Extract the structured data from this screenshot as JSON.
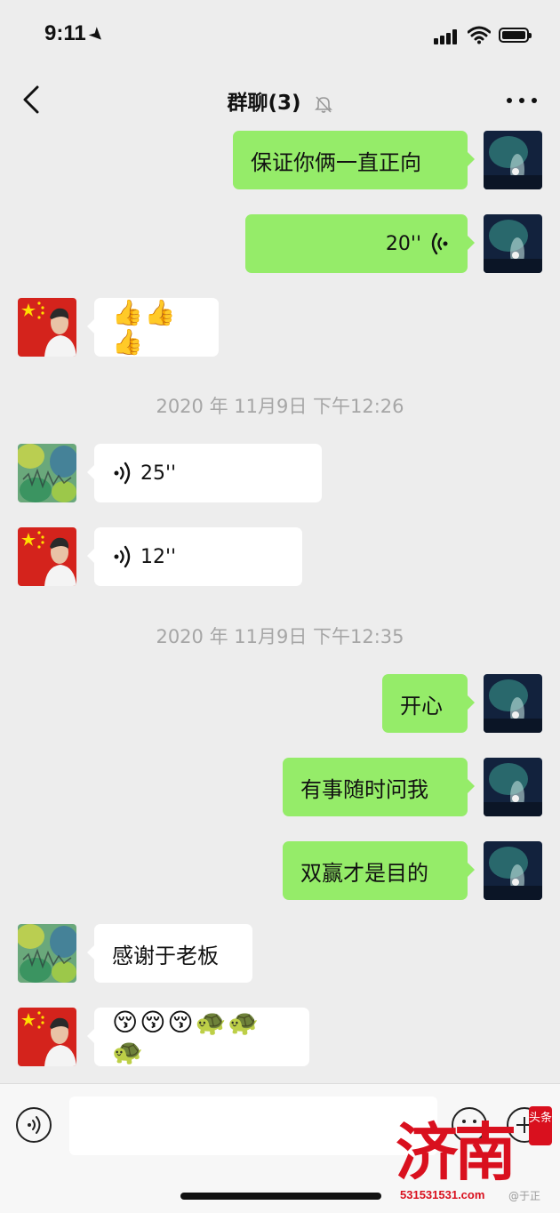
{
  "status_bar": {
    "time": "9:11"
  },
  "nav": {
    "title": "群聊(3)"
  },
  "timestamps": [
    "2020 年 11月9日 下午12:26",
    "2020 年 11月9日 下午12:35"
  ],
  "messages": [
    {
      "sender": "me",
      "type": "text",
      "text": "保证你俩一直正向"
    },
    {
      "sender": "me",
      "type": "voice",
      "duration": "20''"
    },
    {
      "sender": "other-flag",
      "type": "emoji",
      "text": "👍👍👍"
    },
    {
      "sender": "other-colorful",
      "type": "voice",
      "duration": "25''"
    },
    {
      "sender": "other-flag",
      "type": "voice",
      "duration": "12''"
    },
    {
      "sender": "me",
      "type": "text",
      "text": "开心"
    },
    {
      "sender": "me",
      "type": "text",
      "text": "有事随时问我"
    },
    {
      "sender": "me",
      "type": "text",
      "text": "双赢才是目的"
    },
    {
      "sender": "other-colorful",
      "type": "text",
      "text": "感谢于老板"
    },
    {
      "sender": "other-flag",
      "type": "emoji",
      "text": "😚😚😚🐢🐢🐢"
    }
  ],
  "input_bar": {
    "placeholder": ""
  },
  "watermark": {
    "text": "济南",
    "seal": "头条",
    "url": "531531531.com",
    "credit": "@于正"
  },
  "colors": {
    "my_bubble": "#95ec69",
    "other_bubble": "#ffffff",
    "background": "#ededed",
    "watermark": "#d9101e"
  }
}
